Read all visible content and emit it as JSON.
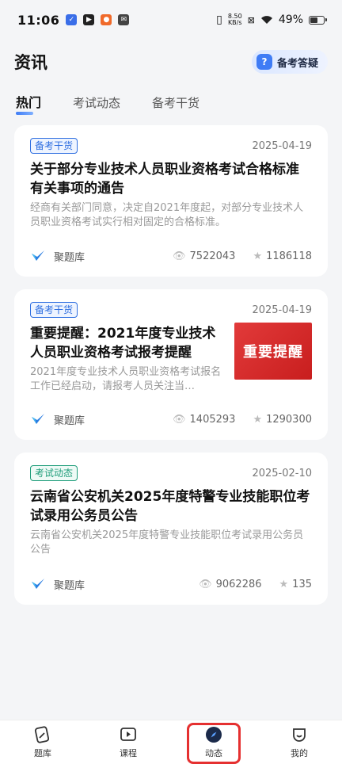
{
  "status": {
    "time": "11:06",
    "net_speed_value": "8.50",
    "net_speed_unit": "KB/s",
    "battery": "49%",
    "battery_level": 0.49
  },
  "header": {
    "title": "资讯",
    "qa_button": "备考答疑"
  },
  "tabs": [
    {
      "label": "热门",
      "active": true
    },
    {
      "label": "考试动态",
      "active": false
    },
    {
      "label": "备考干货",
      "active": false
    }
  ],
  "articles": [
    {
      "tag": "备考干货",
      "date": "2025-04-19",
      "title": "关于部分专业技术人员职业资格考试合格标准有关事项的通告",
      "desc": "经商有关部门同意，决定自2021年度起，对部分专业技术人员职业资格考试实行相对固定的合格标准。",
      "source": "聚题库",
      "views": "7522043",
      "stars": "1186118"
    },
    {
      "tag": "备考干货",
      "date": "2025-04-19",
      "title": "重要提醒：2021年度专业技术人员职业资格考试报考提醒",
      "desc": "2021年度专业技术人员职业资格考试报名工作已经启动，请报考人员关注当…",
      "thumb_text": "重要提醒",
      "source": "聚题库",
      "views": "1405293",
      "stars": "1290300"
    },
    {
      "tag": "考试动态",
      "date": "2025-02-10",
      "title": "云南省公安机关2025年度特警专业技能职位考试录用公务员公告",
      "desc": "云南省公安机关2025年度特警专业技能职位考试录用公务员公告",
      "source": "聚题库",
      "views": "9062286",
      "stars": "135"
    }
  ],
  "bottom_nav": [
    {
      "label": "题库",
      "icon": "question-bank-icon"
    },
    {
      "label": "课程",
      "icon": "play-icon"
    },
    {
      "label": "动态",
      "icon": "compass-icon",
      "active": true
    },
    {
      "label": "我的",
      "icon": "profile-icon"
    }
  ]
}
